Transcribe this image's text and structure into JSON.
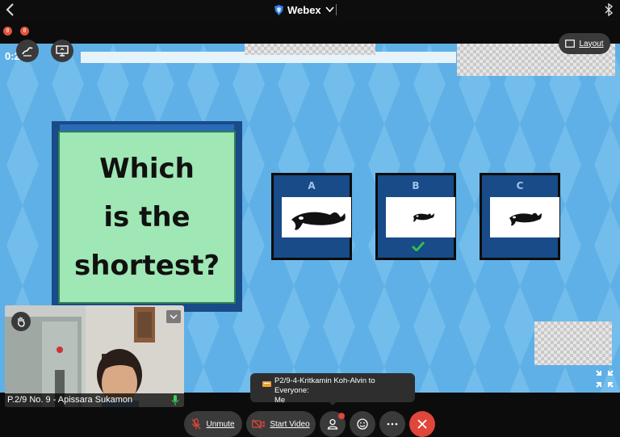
{
  "header": {
    "app_title": "Webex",
    "recording_badges": [
      "8",
      "8"
    ]
  },
  "share": {
    "timer": "0:2",
    "layout_label": "Layout",
    "question": [
      "Which",
      "is the",
      "shortest?"
    ],
    "answers": [
      {
        "letter": "A",
        "correct": false
      },
      {
        "letter": "B",
        "correct": true
      },
      {
        "letter": "C",
        "correct": false
      }
    ]
  },
  "self_view": {
    "name": "P.2/9 No. 9 - Apissara Sukamon"
  },
  "chat_toast": {
    "line1": "P2/9-4-Kritkamin Koh-Alvin to Everyone:",
    "line2": "Me"
  },
  "controls": {
    "unmute_label": "Unmute",
    "start_video_label": "Start Video"
  },
  "colors": {
    "share_bg": "#5fb0e6",
    "card_navy": "#184b87",
    "question_green": "#9fe7b4",
    "leave_red": "#e0463a",
    "check_green": "#2fbf4f"
  },
  "icons": [
    "back-icon",
    "webex-shield-icon",
    "chevron-down-icon",
    "bluetooth-icon",
    "annotate-icon",
    "share-screen-icon",
    "layout-icon",
    "raise-hand-icon",
    "chevron-down-icon",
    "mic-icon",
    "chat-icon",
    "mic-muted-icon",
    "video-off-icon",
    "participants-icon",
    "reactions-icon",
    "more-icon",
    "leave-icon",
    "check-icon",
    "expand-icon"
  ]
}
